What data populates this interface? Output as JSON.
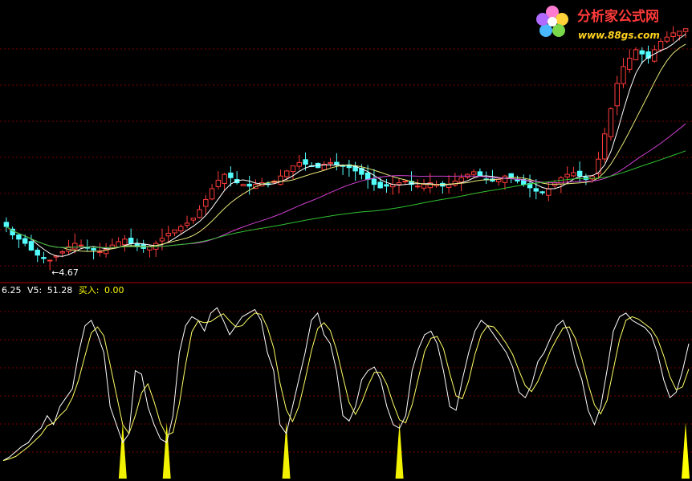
{
  "watermark": {
    "title": "分析家公式网",
    "url": "www.88gs.com"
  },
  "colors": {
    "background": "#000000",
    "grid": "#7a0000",
    "divider": "#b00000",
    "candle_up": "#ff3b3b",
    "candle_down": "#54ffff",
    "ma5": "#ffffff",
    "ma10": "#e8e87a",
    "ma30": "#d040d0",
    "ma60": "#30c030",
    "osc_main": "#ffffff",
    "osc_signal": "#ffff66",
    "buy_bar": "#ffff00",
    "label_white": "#ffffff",
    "label_yellow": "#ffff00"
  },
  "price_panel": {
    "low_marker": "←4.67"
  },
  "indicator_panel": {
    "header_v_prefix": "6.25",
    "header_v5_label": "V5:",
    "header_v5_value": "51.28",
    "header_buy_label": "买入:",
    "header_buy_value": "0.00"
  },
  "chart_data": [
    {
      "type": "candlestick",
      "title": "",
      "xlabel": "",
      "ylabel": "",
      "ylim": [
        4.5,
        7.6
      ],
      "grid": true,
      "low_annotation": 4.67,
      "closes": [
        5.1,
        5.0,
        4.95,
        4.9,
        4.82,
        4.76,
        4.72,
        4.7,
        4.75,
        4.8,
        4.86,
        4.9,
        4.88,
        4.85,
        4.82,
        4.8,
        4.83,
        4.88,
        4.92,
        4.95,
        4.9,
        4.86,
        4.84,
        4.86,
        4.9,
        4.96,
        5.02,
        5.06,
        5.1,
        5.14,
        5.2,
        5.3,
        5.42,
        5.55,
        5.65,
        5.72,
        5.68,
        5.62,
        5.6,
        5.58,
        5.6,
        5.62,
        5.6,
        5.64,
        5.7,
        5.76,
        5.82,
        5.86,
        5.84,
        5.82,
        5.8,
        5.84,
        5.86,
        5.83,
        5.82,
        5.8,
        5.76,
        5.72,
        5.66,
        5.6,
        5.56,
        5.58,
        5.6,
        5.62,
        5.64,
        5.6,
        5.58,
        5.6,
        5.62,
        5.6,
        5.58,
        5.6,
        5.64,
        5.68,
        5.72,
        5.75,
        5.7,
        5.66,
        5.64,
        5.66,
        5.7,
        5.68,
        5.64,
        5.6,
        5.56,
        5.52,
        5.5,
        5.55,
        5.62,
        5.68,
        5.72,
        5.74,
        5.7,
        5.66,
        5.7,
        5.9,
        6.2,
        6.5,
        6.8,
        7.0,
        7.1,
        7.2,
        7.15,
        7.1,
        7.2,
        7.3,
        7.35,
        7.4,
        7.42,
        7.45
      ],
      "series": [
        {
          "name": "",
          "role": "ma5"
        },
        {
          "name": "",
          "role": "ma10"
        },
        {
          "name": "",
          "role": "ma30"
        },
        {
          "name": "",
          "role": "ma60"
        }
      ]
    },
    {
      "type": "line",
      "title": "",
      "xlabel": "",
      "ylabel": "",
      "ylim": [
        0,
        100
      ],
      "grid": true,
      "main": [
        10,
        12,
        15,
        18,
        20,
        25,
        28,
        35,
        30,
        40,
        45,
        50,
        70,
        85,
        88,
        80,
        70,
        40,
        30,
        20,
        25,
        60,
        58,
        40,
        30,
        22,
        20,
        35,
        70,
        85,
        90,
        88,
        82,
        92,
        95,
        88,
        80,
        85,
        90,
        92,
        94,
        88,
        70,
        60,
        30,
        25,
        40,
        55,
        70,
        88,
        92,
        80,
        75,
        60,
        35,
        32,
        40,
        55,
        60,
        62,
        55,
        40,
        30,
        28,
        35,
        60,
        72,
        80,
        82,
        75,
        60,
        40,
        38,
        55,
        70,
        82,
        88,
        85,
        80,
        75,
        70,
        62,
        48,
        45,
        52,
        65,
        70,
        78,
        85,
        88,
        80,
        65,
        55,
        38,
        30,
        40,
        60,
        82,
        90,
        92,
        88,
        86,
        84,
        80,
        70,
        55,
        45,
        48,
        60,
        75
      ]
    }
  ]
}
